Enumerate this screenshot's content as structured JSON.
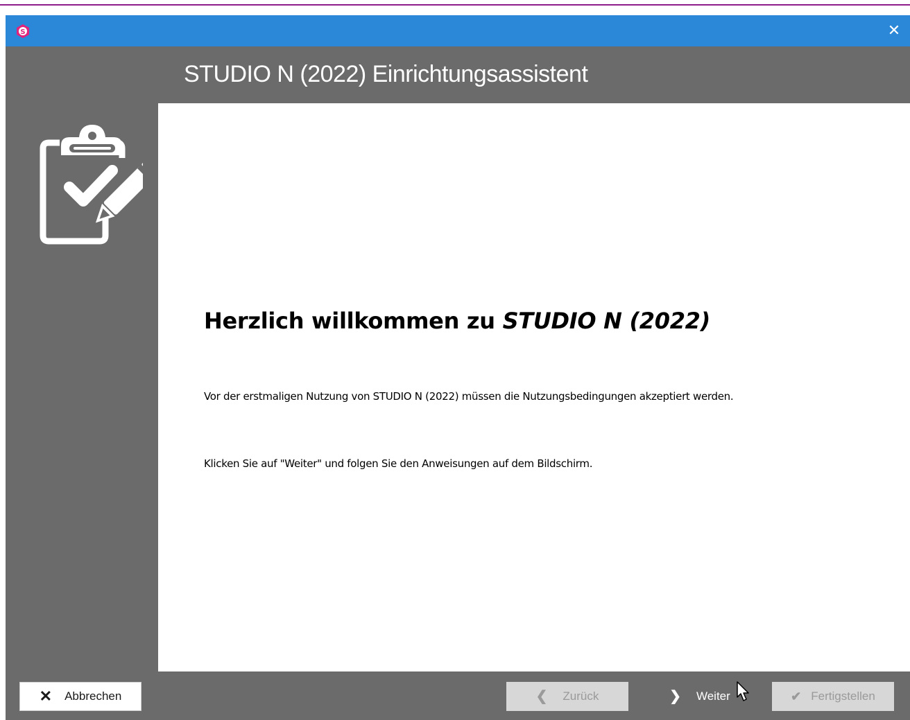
{
  "window": {
    "app_icon": "studio-n-logo-icon",
    "close_glyph": "✕",
    "header_title": "STUDIO N (2022) Einrichtungsassistent",
    "sidebar_icon": "clipboard-check-pencil-icon"
  },
  "content": {
    "welcome_prefix": "Herzlich willkommen zu ",
    "welcome_product": "STUDIO N (2022)",
    "paragraph1": "Vor der erstmaligen Nutzung von STUDIO N (2022) müssen die Nutzungsbedingungen akzeptiert werden.",
    "paragraph2": "Klicken Sie auf \"Weiter\" und folgen Sie den Anweisungen auf dem Bildschirm."
  },
  "buttons": {
    "cancel": {
      "icon": "✕",
      "label": "Abbrechen"
    },
    "back": {
      "icon": "❮",
      "label": "Zurück"
    },
    "next": {
      "icon": "❯",
      "label": "Weiter"
    },
    "finish": {
      "icon": "✔",
      "label": "Fertigstellen"
    }
  },
  "colors": {
    "titlebar": "#2b88d9",
    "frame": "#6b6b6b",
    "accent_line": "#8e1c8a",
    "logo": "#e0237c"
  }
}
